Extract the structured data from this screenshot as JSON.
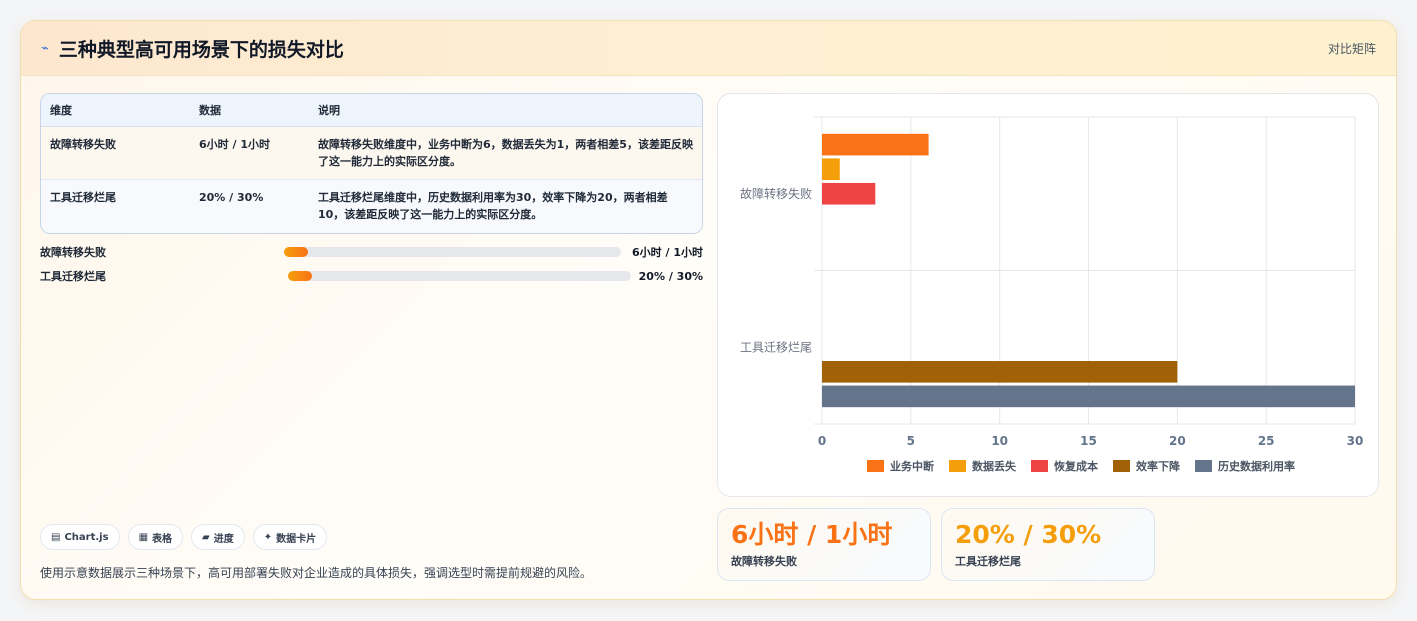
{
  "header": {
    "icon": "pulse-icon",
    "title": "三种典型高可用场景下的损失对比",
    "tag": "对比矩阵"
  },
  "table": {
    "headers": [
      "维度",
      "数据",
      "说明"
    ],
    "rows": [
      {
        "dim": "故障转移失败",
        "data": "6小时 / 1小时",
        "desc": "故障转移失败维度中，业务中断为6，数据丢失为1，两者相差5，该差距反映了这一能力上的实际区分度。"
      },
      {
        "dim": "工具迁移烂尾",
        "data": "20% / 30%",
        "desc": "工具迁移烂尾维度中，历史数据利用率为30，效率下降为20，两者相差10，该差距反映了这一能力上的实际区分度。"
      }
    ]
  },
  "progress": [
    {
      "label": "故障转移失败",
      "value": "6小时 / 1小时",
      "fill": 0.07
    },
    {
      "label": "工具迁移烂尾",
      "value": "20% / 30%",
      "fill": 0.07
    }
  ],
  "chips": [
    {
      "icon": "chart-icon",
      "label": "Chart.js"
    },
    {
      "icon": "table-icon",
      "label": "表格"
    },
    {
      "icon": "progress-icon",
      "label": "进度"
    },
    {
      "icon": "sparkle-icon",
      "label": "数据卡片"
    }
  ],
  "note": "使用示意数据展示三种场景下，高可用部署失败对企业造成的具体损失，强调选型时需提前规避的风险。",
  "chart_data": {
    "type": "bar",
    "orientation": "horizontal",
    "categories": [
      "故障转移失败",
      "工具迁移烂尾"
    ],
    "series": [
      {
        "name": "业务中断",
        "values": [
          6,
          null
        ],
        "color": "#f97316"
      },
      {
        "name": "数据丢失",
        "values": [
          1,
          null
        ],
        "color": "#f59e0b"
      },
      {
        "name": "恢复成本",
        "values": [
          3,
          null
        ],
        "color": "#ef4444"
      },
      {
        "name": "效率下降",
        "values": [
          null,
          20
        ],
        "color": "#a16207"
      },
      {
        "name": "历史数据利用率",
        "values": [
          null,
          30
        ],
        "color": "#64748b"
      }
    ],
    "xlim": [
      0,
      30
    ],
    "xticks": [
      0,
      5,
      10,
      15,
      20,
      25,
      30
    ],
    "grid": true,
    "legend": "bottom"
  },
  "stats": [
    {
      "value": "6小时 / 1小时",
      "label": "故障转移失败"
    },
    {
      "value": "20% / 30%",
      "label": "工具迁移烂尾"
    }
  ]
}
